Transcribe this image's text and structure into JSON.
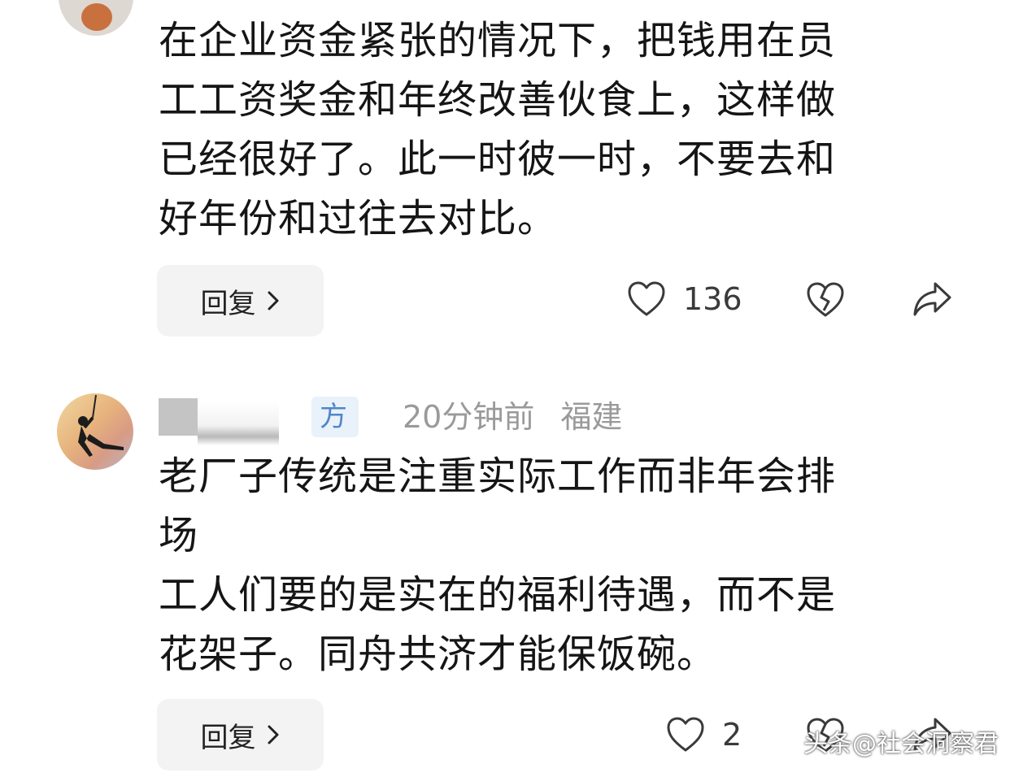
{
  "comments": [
    {
      "text": "在企业资金紧张的情况下，把钱用在员\n工工资奖金和年终改善伙食上，这样做\n已经很好了。此一时彼一时，不要去和\n好年份和过往去对比。",
      "reply_label": "回复",
      "like_count": "136"
    },
    {
      "badge": "方",
      "time": "20分钟前",
      "location": "福建",
      "text": "老厂子传统是注重实际工作而非年会排\n场\n工人们要的是实在的福利待遇，而不是\n花架子。同舟共济才能保饭碗。",
      "reply_label": "回复",
      "like_count": "2"
    }
  ],
  "watermark": "头条@社会洞察君",
  "icons": {
    "like": "heart-outline-icon",
    "dislike": "broken-heart-icon",
    "share": "share-arrow-icon",
    "reply_chevron": "chevron-right-icon"
  },
  "colors": {
    "badge_text": "#4f87c6",
    "badge_bg": "#e9f1fb",
    "meta_text": "#9a9a9a",
    "button_bg": "#f3f3f3"
  }
}
